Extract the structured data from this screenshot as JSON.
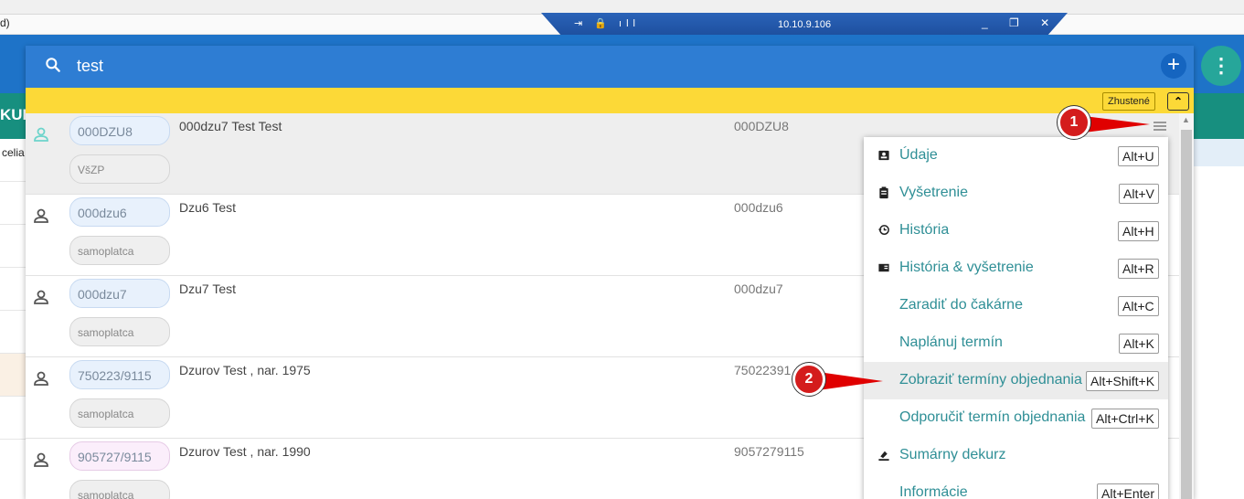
{
  "top_fragment": "d)",
  "rdp": {
    "ip": "10.10.9.106"
  },
  "bg": {
    "teal_label": "KUB",
    "left_cell_text": "celia"
  },
  "search": {
    "value": "test"
  },
  "toolbar": {
    "zhustene": "Zhustené"
  },
  "rows": [
    {
      "id": "000DZU8",
      "insurance": "VšZP",
      "name": "000dzu7 Test Test",
      "code": "000DZU8",
      "icon_color": "#6dd4cb",
      "pink": false
    },
    {
      "id": "000dzu6",
      "insurance": "samoplatca",
      "name": "Dzu6 Test",
      "code": "000dzu6",
      "icon_color": "#555555",
      "pink": false
    },
    {
      "id": "000dzu7",
      "insurance": "samoplatca",
      "name": "Dzu7 Test",
      "code": "000dzu7",
      "icon_color": "#555555",
      "pink": false
    },
    {
      "id": "750223/9115",
      "insurance": "samoplatca",
      "name": "Dzurov Test , nar. 1975",
      "code": "75022391",
      "icon_color": "#555555",
      "pink": false
    },
    {
      "id": "905727/9115",
      "insurance": "samoplatca",
      "name": "Dzurov Test , nar. 1990",
      "code": "9057279115",
      "icon_color": "#555555",
      "pink": true
    }
  ],
  "menu": [
    {
      "label": "Údaje",
      "shortcut": "Alt+U",
      "icon": "id-card-icon"
    },
    {
      "label": "Vyšetrenie",
      "shortcut": "Alt+V",
      "icon": "clipboard-icon"
    },
    {
      "label": "História",
      "shortcut": "Alt+H",
      "icon": "history-icon"
    },
    {
      "label": "História & vyšetrenie",
      "shortcut": "Alt+R",
      "icon": "book-icon"
    },
    {
      "label": "Zaradiť do čakárne",
      "shortcut": "Alt+C",
      "icon": ""
    },
    {
      "label": "Naplánuj termín",
      "shortcut": "Alt+K",
      "icon": ""
    },
    {
      "label": "Zobraziť termíny objednania",
      "shortcut": "Alt+Shift+K",
      "icon": "",
      "highlight": true
    },
    {
      "label": "Odporučiť termín objednania",
      "shortcut": "Alt+Ctrl+K",
      "icon": ""
    },
    {
      "label": "Sumárny dekurz",
      "shortcut": "",
      "icon": "ink-icon"
    },
    {
      "label": "Informácie",
      "shortcut": "Alt+Enter",
      "icon": ""
    }
  ],
  "callouts": [
    "1",
    "2"
  ]
}
